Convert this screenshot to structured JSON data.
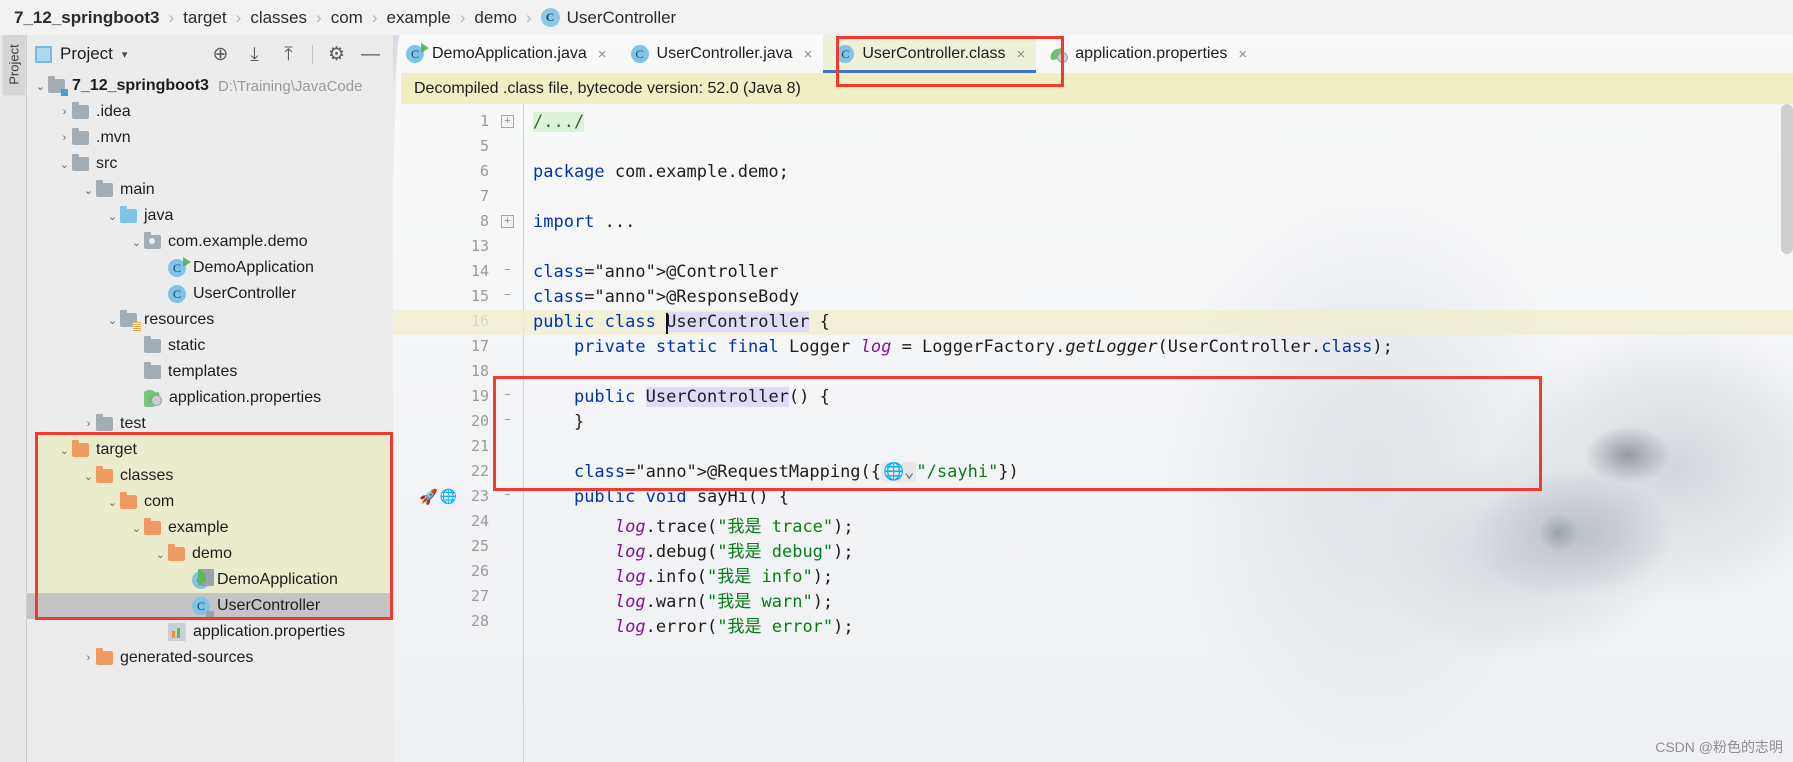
{
  "breadcrumb": {
    "items": [
      "7_12_springboot3",
      "target",
      "classes",
      "com",
      "example",
      "demo",
      "UserController"
    ],
    "separator": "›",
    "class_icon_letter": "C"
  },
  "tool_strip": {
    "label": "Project"
  },
  "project_panel": {
    "title": "Project",
    "caret": "▾",
    "actions": [
      {
        "name": "locate-icon",
        "glyph": "⊕"
      },
      {
        "name": "expand-all-icon",
        "glyph": "⤓"
      },
      {
        "name": "collapse-all-icon",
        "glyph": "⤒"
      },
      {
        "name": "settings-gear-icon",
        "glyph": "⚙"
      },
      {
        "name": "hide-panel-icon",
        "glyph": "—"
      }
    ],
    "tree": [
      {
        "label": "7_12_springboot3",
        "path": "D:\\Training\\JavaCode",
        "depth": 0,
        "arrow": "⌄",
        "icon": "folder-module",
        "bold": true
      },
      {
        "label": ".idea",
        "depth": 1,
        "arrow": "›",
        "icon": "folder"
      },
      {
        "label": ".mvn",
        "depth": 1,
        "arrow": "›",
        "icon": "folder"
      },
      {
        "label": "src",
        "depth": 1,
        "arrow": "⌄",
        "icon": "folder"
      },
      {
        "label": "main",
        "depth": 2,
        "arrow": "⌄",
        "icon": "folder"
      },
      {
        "label": "java",
        "depth": 3,
        "arrow": "⌄",
        "icon": "folder-source"
      },
      {
        "label": "com.example.demo",
        "depth": 4,
        "arrow": "⌄",
        "icon": "folder-package"
      },
      {
        "label": "DemoApplication",
        "depth": 5,
        "arrow": "",
        "icon": "class-runnable"
      },
      {
        "label": "UserController",
        "depth": 5,
        "arrow": "",
        "icon": "class"
      },
      {
        "label": "resources",
        "depth": 3,
        "arrow": "⌄",
        "icon": "folder-resources"
      },
      {
        "label": "static",
        "depth": 4,
        "arrow": "",
        "icon": "folder"
      },
      {
        "label": "templates",
        "depth": 4,
        "arrow": "",
        "icon": "folder"
      },
      {
        "label": "application.properties",
        "depth": 4,
        "arrow": "",
        "icon": "file-properties"
      },
      {
        "label": "test",
        "depth": 2,
        "arrow": "›",
        "icon": "folder"
      },
      {
        "label": "target",
        "depth": 1,
        "arrow": "⌄",
        "icon": "folder-target",
        "highlighted": true
      },
      {
        "label": "classes",
        "depth": 2,
        "arrow": "⌄",
        "icon": "folder-target",
        "highlighted": true
      },
      {
        "label": "com",
        "depth": 3,
        "arrow": "⌄",
        "icon": "folder-target",
        "highlighted": true
      },
      {
        "label": "example",
        "depth": 4,
        "arrow": "⌄",
        "icon": "folder-target",
        "highlighted": true
      },
      {
        "label": "demo",
        "depth": 5,
        "arrow": "⌄",
        "icon": "folder-target",
        "highlighted": true
      },
      {
        "label": "DemoApplication",
        "depth": 6,
        "arrow": "",
        "icon": "class-runnable-locked",
        "highlighted": true
      },
      {
        "label": "UserController",
        "depth": 6,
        "arrow": "",
        "icon": "class-locked",
        "highlighted": true,
        "selected": true
      },
      {
        "label": "application.properties",
        "depth": 5,
        "arrow": "",
        "icon": "file-chart"
      },
      {
        "label": "generated-sources",
        "depth": 2,
        "arrow": "›",
        "icon": "folder-target"
      }
    ]
  },
  "editor": {
    "tabs": [
      {
        "label": "DemoApplication.java",
        "icon": "class-runnable",
        "active": false,
        "close": "×"
      },
      {
        "label": "UserController.java",
        "icon": "class",
        "active": false,
        "close": "×"
      },
      {
        "label": "UserController.class",
        "icon": "class",
        "active": true,
        "close": "×"
      },
      {
        "label": "application.properties",
        "icon": "properties",
        "active": false,
        "close": "×"
      }
    ],
    "banner": "Decompiled .class file, bytecode version: 52.0 (Java 8)",
    "lines": [
      {
        "num": "1",
        "fold": "box",
        "text": "/.../",
        "kind": "comment-fold"
      },
      {
        "num": "5",
        "fold": "",
        "text": ""
      },
      {
        "num": "6",
        "fold": "",
        "text": "package com.example.demo;"
      },
      {
        "num": "7",
        "fold": "",
        "text": ""
      },
      {
        "num": "8",
        "fold": "box",
        "text": "import ..."
      },
      {
        "num": "13",
        "fold": "",
        "text": ""
      },
      {
        "num": "14",
        "fold": "minus",
        "text": "@Controller"
      },
      {
        "num": "15",
        "fold": "minus",
        "text": "@ResponseBody"
      },
      {
        "num": "16",
        "fold": "",
        "text": "public class UserController {"
      },
      {
        "num": "17",
        "fold": "",
        "text": "    private static final Logger log = LoggerFactory.getLogger(UserController.class);"
      },
      {
        "num": "18",
        "fold": "",
        "text": ""
      },
      {
        "num": "19",
        "fold": "minus",
        "text": "    public UserController() {"
      },
      {
        "num": "20",
        "fold": "minus",
        "text": "    }"
      },
      {
        "num": "21",
        "fold": "",
        "text": ""
      },
      {
        "num": "22",
        "fold": "",
        "text": "    @RequestMapping({\"/sayhi\"})"
      },
      {
        "num": "23",
        "fold": "minus",
        "text": "    public void sayHi() {",
        "gutter_icons": [
          "rocket-icon",
          "web-icon"
        ]
      },
      {
        "num": "24",
        "fold": "",
        "text": "        log.trace(\"我是 trace\");"
      },
      {
        "num": "25",
        "fold": "",
        "text": "        log.debug(\"我是 debug\");"
      },
      {
        "num": "26",
        "fold": "",
        "text": "        log.info(\"我是 info\");"
      },
      {
        "num": "27",
        "fold": "",
        "text": "        log.warn(\"我是 warn\");"
      },
      {
        "num": "28",
        "fold": "",
        "text": "        log.error(\"我是 error\");"
      }
    ],
    "request_mapping_icon": "globe-dropdown-icon"
  },
  "watermark": "CSDN @粉色的志明",
  "colors": {
    "accent_red": "#f23a2e",
    "tab_active_bg": "#eff0d8",
    "banner_bg": "#f0eec3",
    "highlight_band": "#eaeccb",
    "keyword": "#0033b3",
    "string": "#067d17",
    "annotation": "#9e880d",
    "field": "#871094"
  }
}
